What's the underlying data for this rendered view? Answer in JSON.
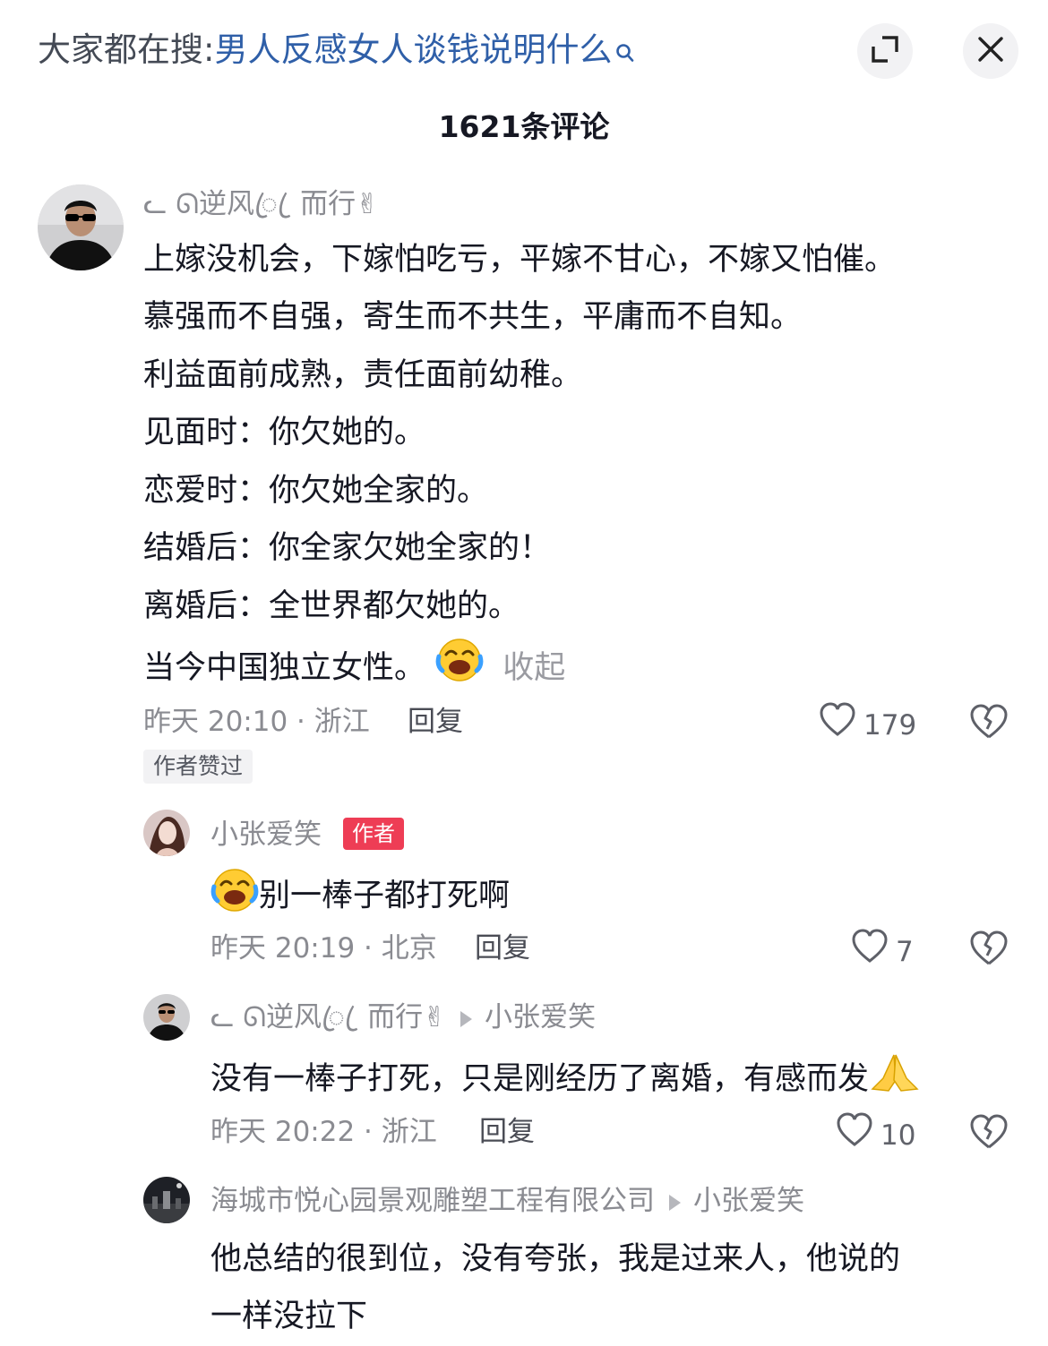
{
  "header": {
    "search_prefix": "大家都在搜:",
    "search_query": "男人反感女人谈钱说明什么",
    "search_icon": "search-icon",
    "expand_icon": "expand-icon",
    "close_icon": "close-icon"
  },
  "comment_count": "1621条评论",
  "comments": [
    {
      "user": "ᓚ ᘏ逆风ꦿ ꦿ 而行✌",
      "lines": [
        "上嫁没机会，下嫁怕吃亏，平嫁不甘心，不嫁又怕催。",
        "慕强而不自强，寄生而不共生，平庸而不自知。",
        "利益面前成熟，责任面前幼稚。",
        "见面时：你欠她的。",
        "恋爱时：你欠她全家的。",
        "结婚后：你全家欠她全家的！",
        "离婚后：全世界都欠她的。",
        "当今中国独立女性。"
      ],
      "emoji": "laughing-crying-emoji",
      "collapse": "收起",
      "time_location": "昨天 20:10 · 浙江",
      "reply": "回复",
      "likes": "179",
      "badge": "作者赞过"
    },
    {
      "user": "小张爱笑",
      "author_tag": "作者",
      "emoji": "laughing-crying-emoji",
      "text": "别一棒子都打死啊",
      "time_location": "昨天 20:19 · 北京",
      "reply": "回复",
      "likes": "7"
    },
    {
      "user": "ᓚ ᘏ逆风ꦿ ꦿ 而行✌",
      "reply_to": "小张爱笑",
      "text": "没有一棒子打死，只是刚经历了离婚，有感而发",
      "emoji": "praying-hands-emoji",
      "time_location": "昨天 20:22 · 浙江",
      "reply": "回复",
      "likes": "10"
    },
    {
      "user": "海城市悦心园景观雕塑工程有限公司",
      "reply_to": "小张爱笑",
      "lines": [
        "他总结的很到位，没有夸张，我是过来人，他说的",
        "一样没拉下"
      ]
    }
  ],
  "colors": {
    "link": "#2f5fa8",
    "author_badge": "#ee3d55",
    "muted": "#8a8b91",
    "text": "#161823"
  }
}
